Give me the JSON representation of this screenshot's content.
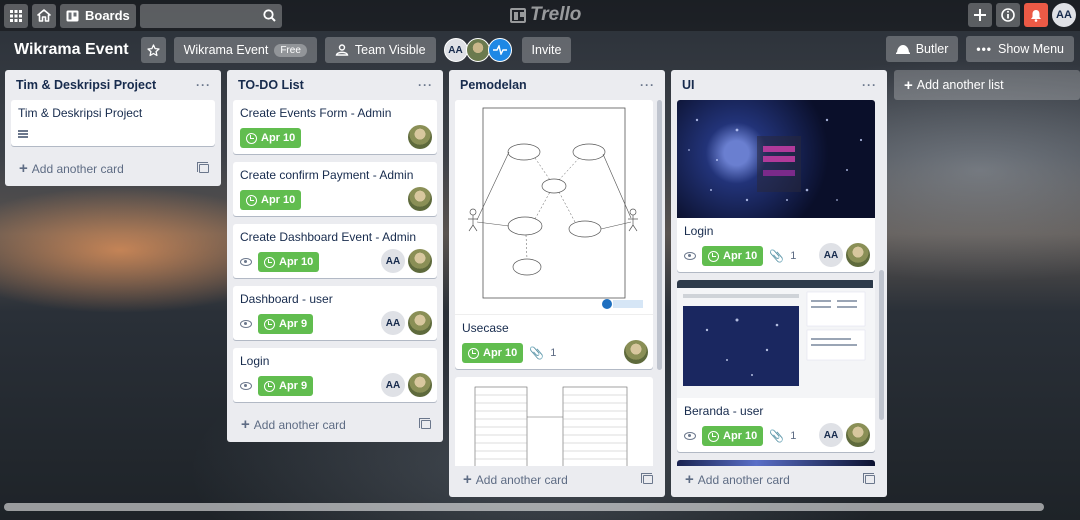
{
  "topbar": {
    "boards_label": "Boards",
    "logo_text": "Trello",
    "user_initials": "AA"
  },
  "board": {
    "title": "Wikrama Event",
    "team_label": "Wikrama Event",
    "team_badge": "Free",
    "visibility_label": "Team Visible",
    "invite_label": "Invite",
    "butler_label": "Butler",
    "show_menu_label": "Show Menu",
    "member_initials": "AA",
    "add_list_label": "Add another list"
  },
  "lists": [
    {
      "title": "Tim & Deskripsi Project",
      "add_card_label": "Add another card",
      "cards": [
        {
          "title": "Tim & Deskripsi Project"
        }
      ]
    },
    {
      "title": "TO-DO List",
      "add_card_label": "Add another card",
      "cards": [
        {
          "title": "Create Events Form - Admin",
          "due": "Apr 10"
        },
        {
          "title": "Create confirm Payment - Admin",
          "due": "Apr 10"
        },
        {
          "title": "Create Dashboard Event - Admin",
          "due": "Apr 10",
          "member": "AA"
        },
        {
          "title": "Dashboard - user",
          "due": "Apr 9",
          "member": "AA"
        },
        {
          "title": "Login",
          "due": "Apr 9",
          "member": "AA"
        }
      ]
    },
    {
      "title": "Pemodelan",
      "add_card_label": "Add another card",
      "cards": [
        {
          "title": "Usecase",
          "due": "Apr 10",
          "attachments": "1"
        }
      ]
    },
    {
      "title": "UI",
      "add_card_label": "Add another card",
      "cards": [
        {
          "title": "Login",
          "due": "Apr 10",
          "attachments": "1",
          "member": "AA"
        },
        {
          "title": "Beranda - user",
          "due": "Apr 10",
          "attachments": "1",
          "member": "AA"
        }
      ]
    }
  ],
  "colors": {
    "due_green": "#61bd4f",
    "list_bg": "#ebecf0",
    "notification_red": "#eb5a46"
  }
}
